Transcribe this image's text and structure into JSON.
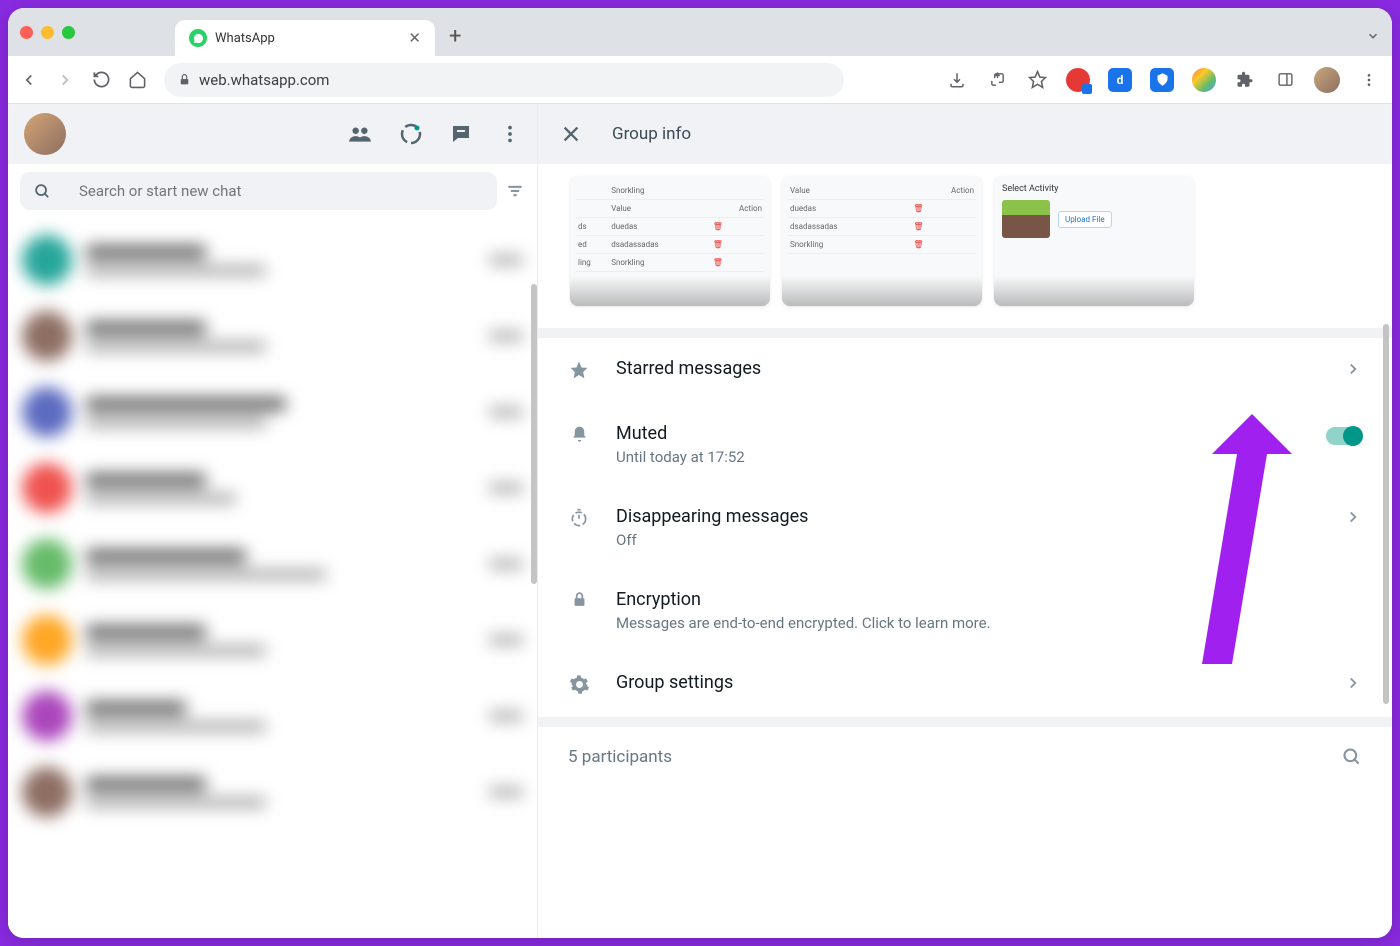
{
  "browser": {
    "tab_title": "WhatsApp",
    "url": "web.whatsapp.com"
  },
  "sidebar": {
    "search_placeholder": "Search or start new chat"
  },
  "panel": {
    "title": "Group info",
    "thumbs": {
      "select_activity": "Select Activity",
      "upload_file": "Upload File",
      "value": "Value",
      "action": "Action",
      "r1": "duedas",
      "r2": "dsadassadas",
      "r3": "Snorkling",
      "snorkling": "Snorkling"
    },
    "starred": {
      "label": "Starred messages"
    },
    "muted": {
      "label": "Muted",
      "sub": "Until today at 17:52"
    },
    "disappearing": {
      "label": "Disappearing messages",
      "sub": "Off"
    },
    "encryption": {
      "label": "Encryption",
      "sub": "Messages are end-to-end encrypted. Click to learn more."
    },
    "group_settings": {
      "label": "Group settings"
    },
    "participants": "5 participants"
  }
}
